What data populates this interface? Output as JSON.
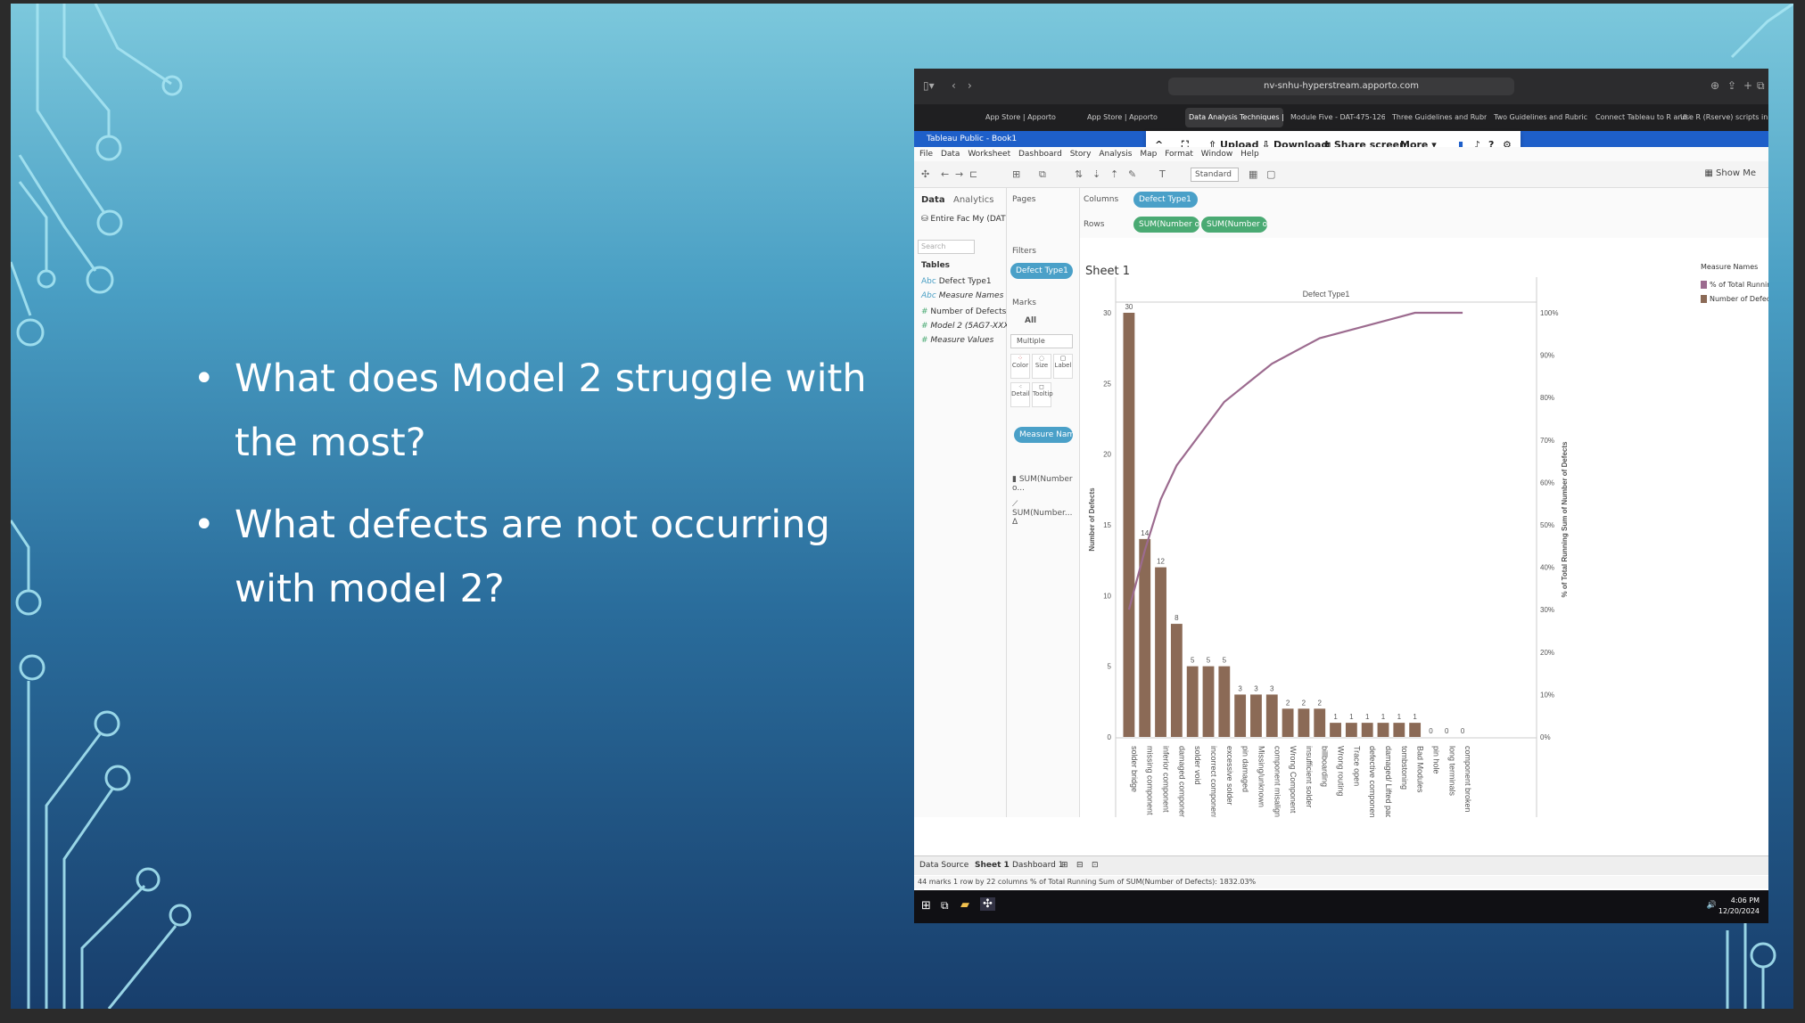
{
  "slide": {
    "bullets": [
      "What does Model 2 struggle with the most?",
      "What defects are not occurring with model 2?"
    ]
  },
  "browser": {
    "url": "nv-snhu-hyperstream.apporto.com",
    "tabs": [
      "App Store | Apporto",
      "App Store | Apporto",
      "Data Analysis Techniques | App...",
      "Module Five - DAT-475-12650-...",
      "Three Guidelines and Rubric - D...",
      "Two Guidelines and Rubric - DA...",
      "Connect Tableau to R and Using...",
      "Use R (Rserve) scripts in your fl..."
    ],
    "window_title": "Tableau Public - Book1"
  },
  "share_bar": {
    "upload": "Upload",
    "download": "Download",
    "share_screen": "Share screen",
    "more": "More"
  },
  "tableau": {
    "menu": [
      "File",
      "Data",
      "Worksheet",
      "Dashboard",
      "Story",
      "Analysis",
      "Map",
      "Format",
      "Window",
      "Help"
    ],
    "toolbar": {
      "fit": "Standard",
      "show_me": "Show Me"
    },
    "data_pane": {
      "tab_data": "Data",
      "tab_analytics": "Analytics",
      "source": "Entire Fac My (DAT 475...",
      "search_placeholder": "Search",
      "tables_label": "Tables",
      "fields": [
        "Defect Type1",
        "Measure Names",
        "Number of Defects",
        "Model 2 (5AG7-XXX-00 (C...",
        "Measure Values"
      ]
    },
    "cards": {
      "pages": "Pages",
      "filters": "Filters",
      "filter_pill": "Defect Type1",
      "marks": "Marks",
      "marks_all": "All",
      "mark_type": "Multiple",
      "btn_color": "Color",
      "btn_size": "Size",
      "btn_label": "Label",
      "btn_detail": "Detail",
      "btn_tooltip": "Tooltip",
      "measure_pill": "Measure Nam..",
      "sum1": "SUM(Number o...",
      "sum2": "SUM(Number... Δ"
    },
    "shelves": {
      "columns_label": "Columns",
      "columns_pill": "Defect Type1",
      "rows_label": "Rows",
      "rows_pill1": "SUM(Number of Defe...",
      "rows_pill2": "SUM(Number of D... Δ"
    },
    "sheet_title": "Sheet 1",
    "legend": {
      "title": "Measure Names",
      "items": [
        "% of Total Running S...",
        "Number of Defects"
      ],
      "colors": [
        "#9c6b8f",
        "#8b6a56"
      ]
    },
    "sheet_tabs": [
      "Data Source",
      "Sheet 1",
      "Dashboard 1"
    ],
    "status": "44 marks   1 row by 22 columns   % of Total Running Sum of SUM(Number of Defects): 1832.03%",
    "clock_time": "4:06 PM",
    "clock_date": "12/20/2024"
  },
  "chart_data": {
    "type": "bar",
    "title": "",
    "header": "Defect Type1",
    "ylabel": "Number of Defects",
    "y2label": "% of Total Running Sum of Number of Defects",
    "ylim": [
      0,
      30
    ],
    "y_ticks": [
      0,
      5,
      10,
      15,
      20,
      25,
      30
    ],
    "y2_ticks": [
      "0%",
      "10%",
      "20%",
      "30%",
      "40%",
      "50%",
      "60%",
      "70%",
      "80%",
      "90%",
      "100%"
    ],
    "categories": [
      "solder bridge",
      "missing component",
      "inferior component",
      "damaged component",
      "solder void",
      "incorrect component",
      "excessive solder",
      "pin damaged",
      "Missing/unknown",
      "component misalignment",
      "Wrong Component",
      "insufficient solder",
      "billboarding",
      "Wrong routing",
      "Trace open",
      "defective component",
      "damaged/ Lifted pad",
      "tombstoning",
      "Bad Modules",
      "pin hole",
      "long terminals",
      "component broken"
    ],
    "series": [
      {
        "name": "Number of Defects",
        "values": [
          30,
          14,
          12,
          8,
          5,
          5,
          5,
          3,
          3,
          3,
          2,
          2,
          2,
          1,
          1,
          1,
          1,
          1,
          1,
          0,
          0,
          0
        ]
      },
      {
        "name": "% of Total Running S...",
        "values": [
          0.3,
          0.44,
          0.56,
          0.64,
          0.69,
          0.74,
          0.79,
          0.82,
          0.85,
          0.88,
          0.9,
          0.92,
          0.94,
          0.95,
          0.96,
          0.97,
          0.98,
          0.99,
          1.0,
          1.0,
          1.0,
          1.0
        ]
      }
    ]
  }
}
